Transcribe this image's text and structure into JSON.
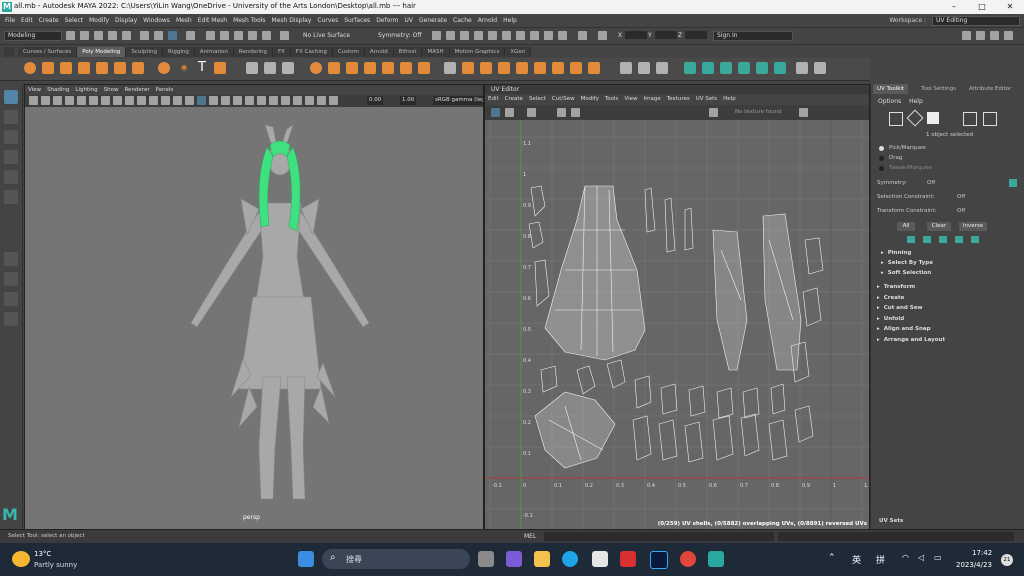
{
  "window": {
    "title": "all.mb - Autodesk MAYA 2022: C:\\Users\\YiLin Wang\\OneDrive - University of the Arts London\\Desktop\\all.mb  ---  hair",
    "app_letter": "M"
  },
  "menubar": {
    "items": [
      "File",
      "Edit",
      "Create",
      "Select",
      "Modify",
      "Display",
      "Windows",
      "Mesh",
      "Edit Mesh",
      "Mesh Tools",
      "Mesh Display",
      "Curves",
      "Surfaces",
      "Deform",
      "UV",
      "Generate",
      "Cache",
      "Arnold",
      "Help"
    ],
    "workspace_label": "Workspace :",
    "workspace_value": "UV Editing"
  },
  "statusline": {
    "mode_value": "Modeling",
    "live_surface": "No Live Surface",
    "symmetry": "Symmetry: Off",
    "x_label": "X",
    "y_label": "Y",
    "z_label": "Z",
    "sign_in": "Sign In"
  },
  "shelf": {
    "tabs": [
      "Curves / Surfaces",
      "Poly Modeling",
      "Sculpting",
      "Rigging",
      "Animation",
      "Rendering",
      "FX",
      "FX Caching",
      "Custom",
      "Arnold",
      "Bifrost",
      "MASH",
      "Motion Graphics",
      "XGen"
    ],
    "active_tab": "Poly Modeling"
  },
  "viewport": {
    "menu": [
      "View",
      "Shading",
      "Lighting",
      "Show",
      "Renderer",
      "Panels"
    ],
    "field_1": "0.00",
    "field_2": "1.00",
    "color_space": "sRGB gamma (leg",
    "camera_label": "persp",
    "hair_color": "#3fe07f",
    "body_color": "#a8a8a8"
  },
  "uv_editor": {
    "title": "UV Editor",
    "menu": [
      "Edit",
      "Create",
      "Select",
      "Cut/Sew",
      "Modify",
      "Tools",
      "View",
      "Image",
      "Textures",
      "UV Sets",
      "Help"
    ],
    "no_texture": "No texture found",
    "axis_ticks_x": [
      "-0.1",
      "0",
      "0.1",
      "0.2",
      "0.3",
      "0.4",
      "0.5",
      "0.6",
      "0.7",
      "0.8",
      "0.9",
      "1",
      "1.1"
    ],
    "axis_ticks_y": [
      "1.1",
      "1",
      "0.9",
      "0.8",
      "0.7",
      "0.6",
      "0.5",
      "0.4",
      "0.3",
      "0.2",
      "0.1",
      "-0.1"
    ],
    "status": "(0/259) UV shells, (0/5882) overlapping UVs, (0/8891) reversed UVs"
  },
  "uv_toolkit": {
    "tabs": [
      "UV Toolkit",
      "Tool Settings",
      "Attribute Editor"
    ],
    "active_tab": "UV Toolkit",
    "menu": [
      "Options",
      "Help"
    ],
    "selection_info": "1 object selected",
    "modes": [
      "Pick/Marquee",
      "Drag",
      "Tweak/Marquee"
    ],
    "symmetry_label": "Symmetry:",
    "symmetry_value": "Off",
    "selection_constraint_label": "Selection Constraint:",
    "selection_constraint_value": "Off",
    "transform_constraint_label": "Transform Constraint:",
    "transform_constraint_value": "Off",
    "buttons": [
      "All",
      "Clear",
      "Inverse"
    ],
    "subsections": [
      "Pinning",
      "Select By Type",
      "Soft Selection"
    ],
    "sections": [
      "Transform",
      "Create",
      "Cut and Sew",
      "Unfold",
      "Align and Snap",
      "Arrange and Layout"
    ],
    "uv_sets": "UV Sets"
  },
  "helpline": {
    "text": "Select Tool: select an object",
    "mel_label": "MEL"
  },
  "taskbar": {
    "temperature": "13°C",
    "weather": "Partly sunny",
    "search_placeholder": "搜尋",
    "lang_1": "英",
    "lang_2": "拼",
    "time": "17:42",
    "date": "2023/4/23",
    "notif_count": "21"
  }
}
